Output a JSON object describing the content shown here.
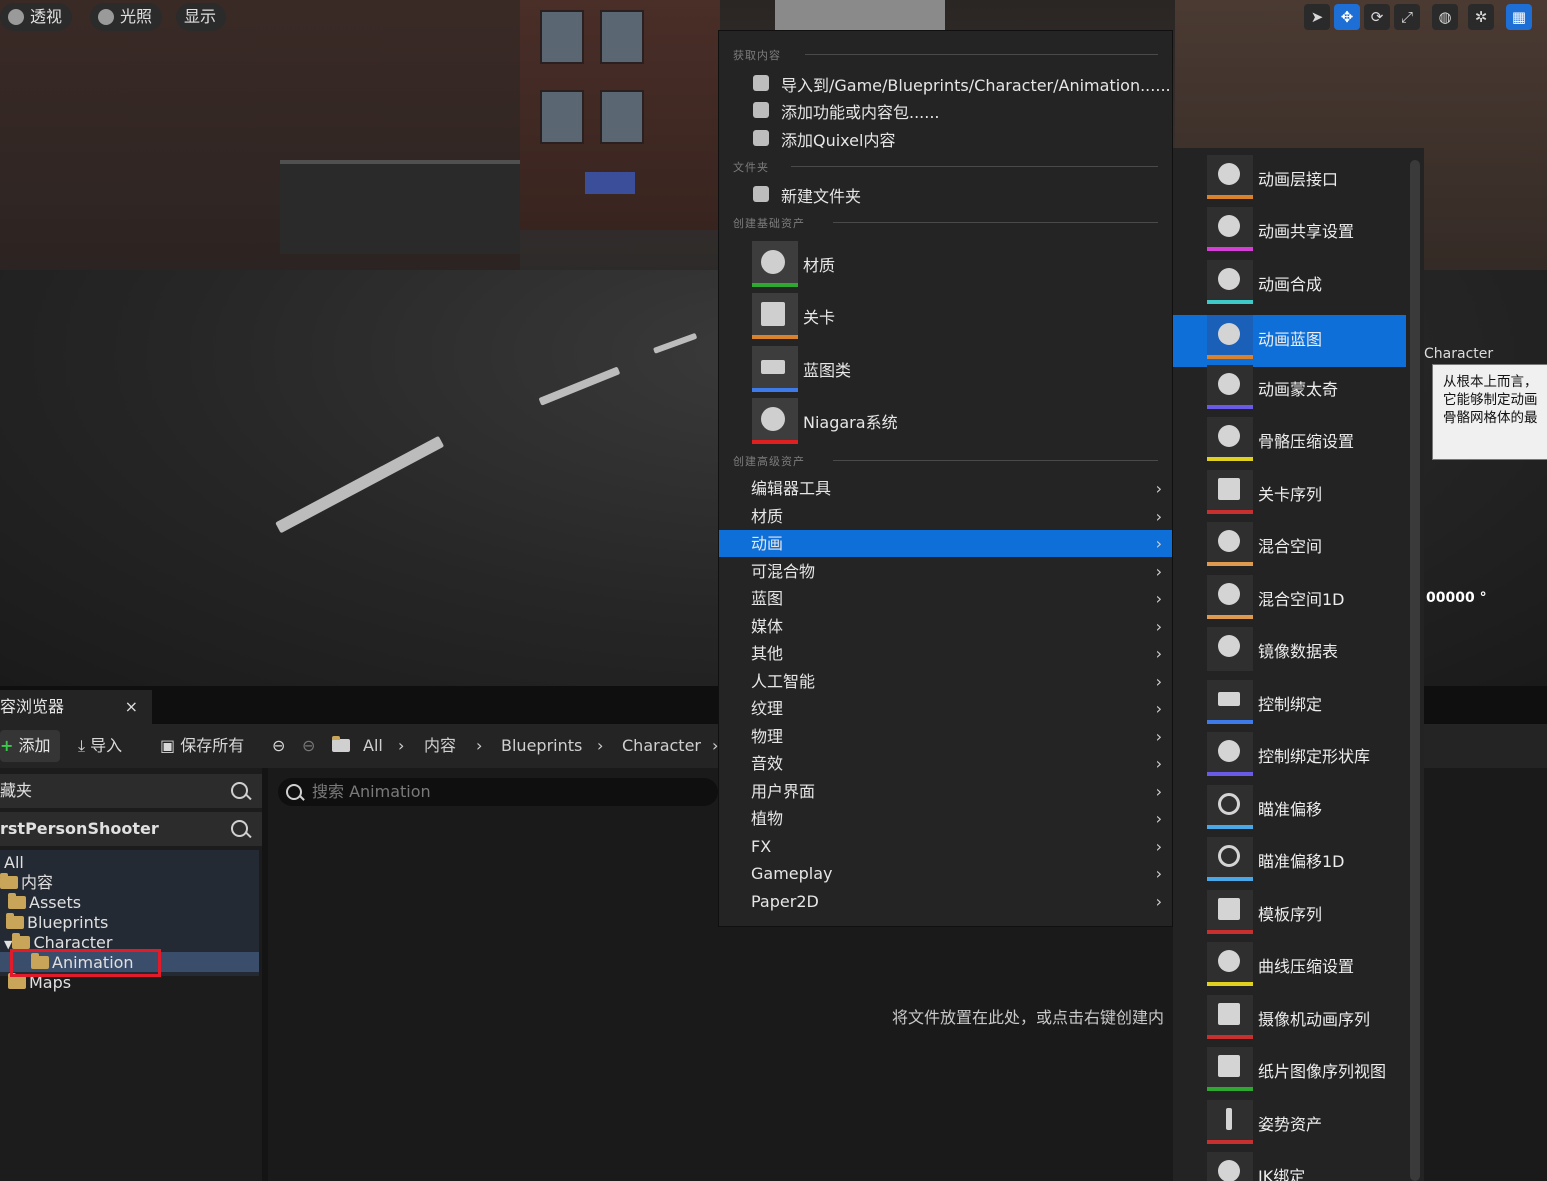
{
  "viewport": {
    "pills": [
      "透视",
      "光照",
      "显示"
    ],
    "toolbar_buttons": [
      "select-icon",
      "move-icon",
      "rotate-icon",
      "scale-icon",
      "world-icon",
      "surface-snap-icon",
      "grid-icon"
    ],
    "tooltip_lines": [
      "从根本上而言，",
      "它能够制定动画",
      "骨骼网格体的最"
    ],
    "character_label": "Character",
    "degree_label": "00000 °"
  },
  "content_browser": {
    "tab_title": "容浏览器",
    "tab_close": "×",
    "toolbar": {
      "add": "添加",
      "import": "导入",
      "save_all": "保存所有"
    },
    "breadcrumbs": [
      "All",
      "内容",
      "Blueprints",
      "Character"
    ],
    "favorites_label": "藏夹",
    "project_label": "rstPersonShooter",
    "tree": [
      {
        "label": "All"
      },
      {
        "label": "内容"
      },
      {
        "label": "Assets"
      },
      {
        "label": "Blueprints"
      },
      {
        "label": "Character"
      },
      {
        "label": "Animation"
      },
      {
        "label": "Maps"
      }
    ],
    "search_placeholder": "搜索 Animation",
    "drop_hint": "将文件放置在此处，或点击右键创建内"
  },
  "context_menu": {
    "sections": {
      "get_content": "获取内容",
      "folder": "文件夹",
      "basic_assets": "创建基础资产",
      "advanced_assets": "创建高级资产"
    },
    "get_content_items": [
      "导入到/Game/Blueprints/Character/Animation......",
      "添加功能或内容包......",
      "添加Quixel内容"
    ],
    "folder_items": [
      "新建文件夹"
    ],
    "basic_assets": [
      {
        "label": "材质",
        "color": "#2fa832"
      },
      {
        "label": "关卡",
        "color": "#d9822b"
      },
      {
        "label": "蓝图类",
        "color": "#3f7be8"
      },
      {
        "label": "Niagara系统",
        "color": "#e02020"
      }
    ],
    "advanced_assets": [
      "编辑器工具",
      "材质",
      "动画",
      "可混合物",
      "蓝图",
      "媒体",
      "其他",
      "人工智能",
      "纹理",
      "物理",
      "音效",
      "用户界面",
      "植物",
      "FX",
      "Gameplay",
      "Paper2D"
    ],
    "highlighted": "动画",
    "arrow": "›"
  },
  "animation_submenu": {
    "items": [
      {
        "label": "动画层接口",
        "color": "#d9822b"
      },
      {
        "label": "动画共享设置",
        "color": "#d53fd5"
      },
      {
        "label": "动画合成",
        "color": "#3fc8c8"
      },
      {
        "label": "动画蓝图",
        "color": "#d9822b"
      },
      {
        "label": "动画蒙太奇",
        "color": "#6a5ae8"
      },
      {
        "label": "骨骼压缩设置",
        "color": "#e0d020"
      },
      {
        "label": "关卡序列",
        "color": "#c83030"
      },
      {
        "label": "混合空间",
        "color": "#e09a50"
      },
      {
        "label": "混合空间1D",
        "color": "#e09a50"
      },
      {
        "label": "镜像数据表",
        "color": "#2f2f2f"
      },
      {
        "label": "控制绑定",
        "color": "#3f7be8"
      },
      {
        "label": "控制绑定形状库",
        "color": "#6a5ae8"
      },
      {
        "label": "瞄准偏移",
        "color": "#4aa8e8"
      },
      {
        "label": "瞄准偏移1D",
        "color": "#4aa8e8"
      },
      {
        "label": "模板序列",
        "color": "#c83030"
      },
      {
        "label": "曲线压缩设置",
        "color": "#e0d020"
      },
      {
        "label": "摄像机动画序列",
        "color": "#c83030"
      },
      {
        "label": "纸片图像序列视图",
        "color": "#2fa832"
      },
      {
        "label": "姿势资产",
        "color": "#c83030"
      },
      {
        "label": "IK绑定",
        "color": "#c83030"
      }
    ],
    "highlighted": "动画蓝图"
  }
}
